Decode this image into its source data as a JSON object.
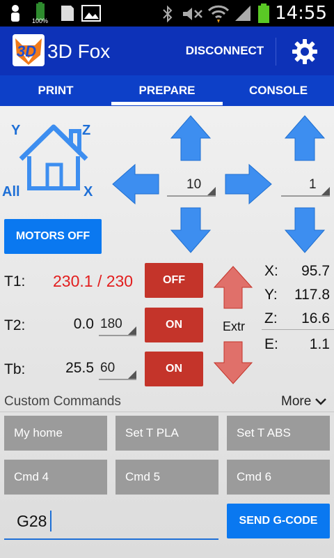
{
  "status_bar": {
    "clock": "14:55",
    "battery_percent": "100%"
  },
  "app": {
    "title": "3D Fox",
    "logo_text": "3D",
    "disconnect_label": "DISCONNECT"
  },
  "tabs": [
    {
      "label": "PRINT"
    },
    {
      "label": "PREPARE",
      "active": true
    },
    {
      "label": "CONSOLE"
    }
  ],
  "jog": {
    "home_labels": {
      "y": "Y",
      "z": "Z",
      "all": "All",
      "x": "X"
    },
    "xy_step": "10",
    "z_step": "1",
    "motors_off_label": "MOTORS OFF",
    "extr_label": "Extr"
  },
  "temps": [
    {
      "label": "T1:",
      "value": "230.1 / 230",
      "button": "OFF"
    },
    {
      "label": "T2:",
      "value": "0.0",
      "target": "180",
      "button": "ON"
    },
    {
      "label": "Tb:",
      "value": "25.5",
      "target": "60",
      "button": "ON"
    }
  ],
  "coords": {
    "x_label": "X:",
    "x": "95.7",
    "y_label": "Y:",
    "y": "117.8",
    "z_label": "Z:",
    "z": "16.6",
    "e_label": "E:",
    "e": "1.1"
  },
  "custom": {
    "title": "Custom Commands",
    "more_label": "More",
    "commands": [
      "My home",
      "Set T PLA",
      "Set T ABS",
      "Cmd 4",
      "Cmd 5",
      "Cmd 6"
    ]
  },
  "gcode": {
    "input_value": "G28",
    "send_label": "SEND G-CODE"
  },
  "colors": {
    "app_bar": "#0d32b8",
    "tab_bar": "#0d40c8",
    "accent": "#0a78f0",
    "danger": "#c4342a",
    "temp_hot": "#e21d1d"
  }
}
